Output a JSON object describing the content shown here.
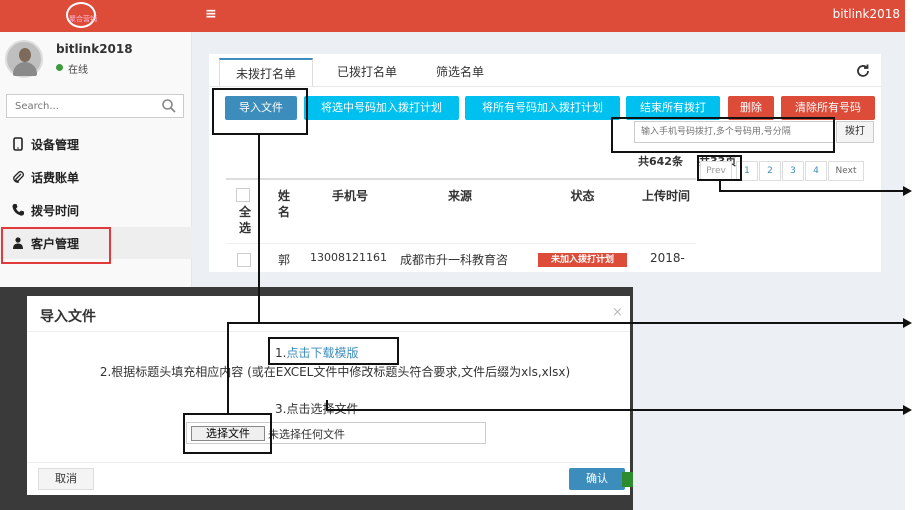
{
  "header": {
    "logo_text": "聚合营销",
    "user": "bitlink2018",
    "menu_icon": "hamburger-icon",
    "brand_color": "#dd4b39"
  },
  "sidebar": {
    "user_name": "bitlink2018",
    "status": "在线",
    "search_placeholder": "Search...",
    "items": [
      {
        "label": "设备管理",
        "icon": "mobile-icon"
      },
      {
        "label": "话费账单",
        "icon": "paperclip-icon"
      },
      {
        "label": "拨号时间",
        "icon": "phone-icon"
      },
      {
        "label": "客户管理",
        "icon": "users-icon"
      }
    ]
  },
  "tabs": [
    "未拨打名单",
    "已拨打名单",
    "筛选名单"
  ],
  "toolbar": {
    "import": "导入文件",
    "add_selected": "将选中号码加入拨打计划",
    "add_all": "将所有号码加入拨打计划",
    "end_all": "结束所有拨打",
    "delete": "删除",
    "clear_all": "清除所有号码"
  },
  "dial": {
    "placeholder": "输入手机号码拨打,多个号码用,号分隔",
    "button": "拨打"
  },
  "summary": {
    "total_count": "共642条",
    "total_pages": "共33页"
  },
  "pagination": [
    "Prev",
    "1",
    "2",
    "3",
    "4",
    "Next"
  ],
  "table": {
    "headers": {
      "select_all": "全选",
      "name": "姓名",
      "phone": "手机号",
      "source": "来源",
      "status": "状态",
      "upload_time": "上传时间"
    },
    "rows": [
      {
        "name": "郭",
        "phone": "13008121161",
        "source": "成都市升一科教育咨",
        "status": "未加入拨打计划",
        "upload_time": "2018-"
      }
    ]
  },
  "modal": {
    "title": "导入文件",
    "close": "×",
    "step1_prefix": "1.",
    "step1_link": "点击下载模版",
    "step2": "2.根据标题头填充相应内容 (或在EXCEL文件中修改标题头符合要求,文件后缀为xls,xlsx)",
    "step3": "3.点击选择文件",
    "file_button": "选择文件",
    "file_none": "未选择任何文件",
    "cancel": "取消",
    "confirm": "确认"
  }
}
